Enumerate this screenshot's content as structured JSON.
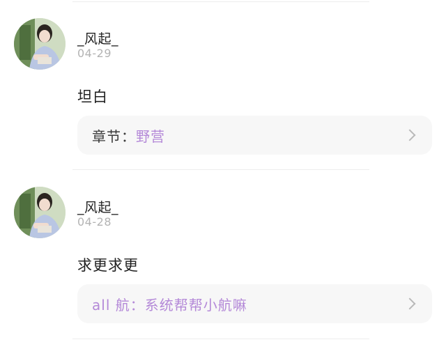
{
  "comments": [
    {
      "username": "_风起_",
      "date": "04-29",
      "text": "坦白",
      "chapter_prefix": "章节：",
      "chapter_name": "野营"
    },
    {
      "username": "_风起_",
      "date": "04-28",
      "text": "求更求更",
      "chapter_prefix": "all 航：系统帮帮小航嘛",
      "chapter_name": ""
    }
  ],
  "colors": {
    "accent": "#b489d8",
    "muted": "#b3b3b3",
    "card_bg": "#f7f7f7"
  },
  "icons": {
    "chevron": "chevron-right-icon"
  }
}
